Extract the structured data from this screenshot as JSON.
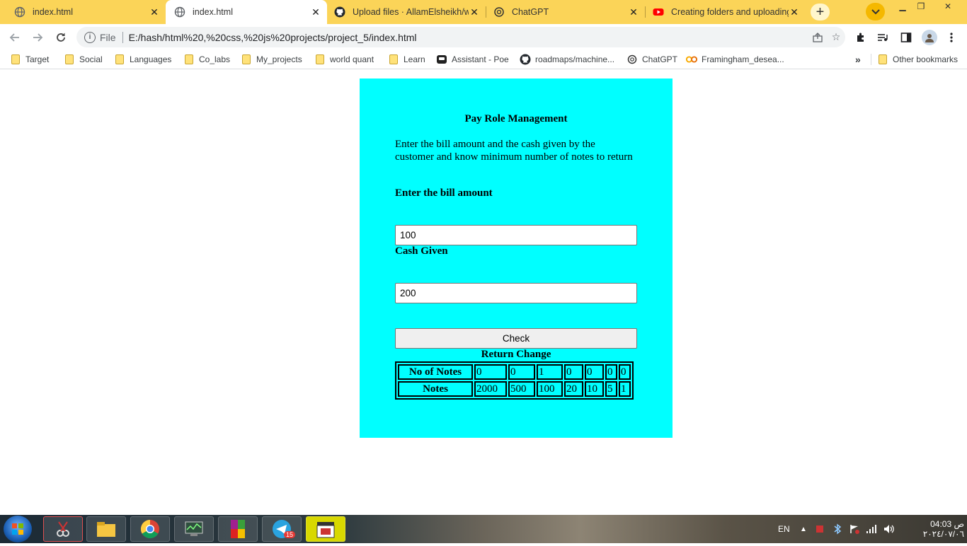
{
  "browser": {
    "tabs": [
      {
        "title": "index.html",
        "icon": "globe-icon",
        "active": false
      },
      {
        "title": "index.html",
        "icon": "globe-icon",
        "active": true
      },
      {
        "title": "Upload files · AllamElsheikh/w",
        "icon": "github-icon",
        "active": false
      },
      {
        "title": "ChatGPT",
        "icon": "chatgpt-icon",
        "active": false
      },
      {
        "title": "Creating folders and uploading",
        "icon": "youtube-icon",
        "active": false
      }
    ],
    "omnibox": {
      "scheme_label": "File",
      "url": "E:/hash/html%20,%20css,%20js%20projects/project_5/index.html"
    },
    "bookmarks": [
      {
        "label": "Target",
        "icon": "folder-icon"
      },
      {
        "label": "Social",
        "icon": "folder-icon"
      },
      {
        "label": "Languages",
        "icon": "folder-icon"
      },
      {
        "label": "Co_labs",
        "icon": "folder-icon"
      },
      {
        "label": "My_projects",
        "icon": "folder-icon"
      },
      {
        "label": "world quant",
        "icon": "folder-icon"
      },
      {
        "label": "Learn",
        "icon": "folder-icon"
      },
      {
        "label": "Assistant - Poe",
        "icon": "poe-icon"
      },
      {
        "label": "roadmaps/machine...",
        "icon": "github-icon"
      },
      {
        "label": "ChatGPT",
        "icon": "chatgpt-icon"
      },
      {
        "label": "Framingham_desea...",
        "icon": "colab-icon"
      }
    ],
    "overflow_label": "»",
    "other_bookmarks": "Other bookmarks"
  },
  "page": {
    "title": "Pay Role Management",
    "description": "Enter the bill amount and the cash given by the customer and know minimum number of notes to return",
    "bill_label": "Enter the bill amount",
    "bill_value": "100",
    "cash_label": "Cash Given",
    "cash_value": "200",
    "check_button": "Check",
    "return_heading": "Return Change",
    "table": {
      "row1_header": "No of Notes",
      "row1": [
        "0",
        "0",
        "1",
        "0",
        "0",
        "0",
        "0"
      ],
      "row2_header": "Notes",
      "row2": [
        "2000",
        "500",
        "100",
        "20",
        "10",
        "5",
        "1"
      ]
    }
  },
  "taskbar": {
    "language": "EN",
    "time": "04:03 ص",
    "date": "٢٠٢٤/٠٧/٠٦",
    "telegram_badge": "15"
  }
}
